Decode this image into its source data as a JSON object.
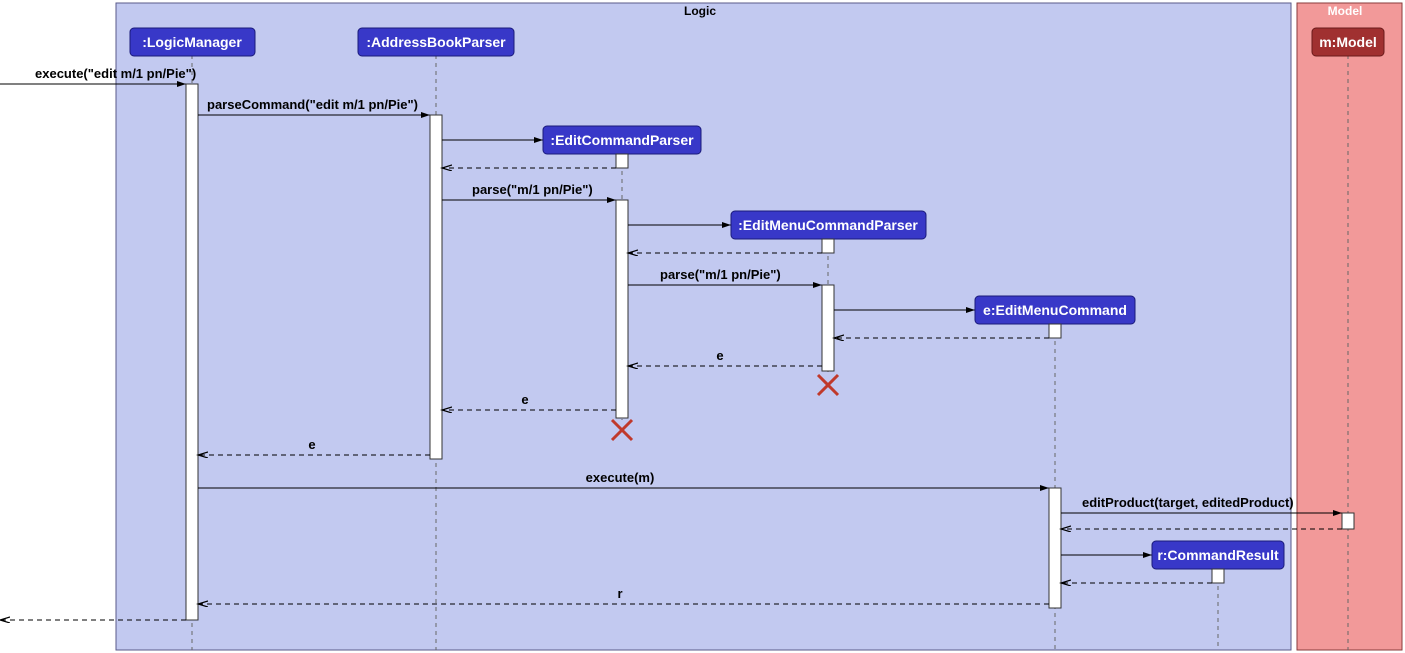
{
  "frames": {
    "logic": {
      "title": "Logic"
    },
    "model": {
      "title": "Model"
    }
  },
  "participants": {
    "logicManager": ":LogicManager",
    "addressBookParser": ":AddressBookParser",
    "editCommandParser": ":EditCommandParser",
    "editMenuCommandParser": ":EditMenuCommandParser",
    "editMenuCommand": "e:EditMenuCommand",
    "commandResult": "r:CommandResult",
    "model": "m:Model"
  },
  "messages": {
    "execute1": "execute(\"edit m/1 pn/Pie\")",
    "parseCommand": "parseCommand(\"edit m/1 pn/Pie\")",
    "parse1": "parse(\"m/1 pn/Pie\")",
    "parse2": "parse(\"m/1 pn/Pie\")",
    "ret_e1": "e",
    "ret_e2": "e",
    "ret_e3": "e",
    "executeM": "execute(m)",
    "editProduct": "editProduct(target, editedProduct)",
    "ret_r": "r"
  },
  "chart_data": {
    "type": "sequence-diagram",
    "frames": [
      {
        "name": "Logic",
        "participants": [
          "LogicManager",
          "AddressBookParser",
          "EditCommandParser",
          "EditMenuCommandParser",
          "EditMenuCommand",
          "CommandResult"
        ]
      },
      {
        "name": "Model",
        "participants": [
          "Model"
        ]
      }
    ],
    "participants": [
      {
        "id": "lm",
        "label": ":LogicManager",
        "created_at_start": true
      },
      {
        "id": "abp",
        "label": ":AddressBookParser",
        "created_at_start": true
      },
      {
        "id": "ecp",
        "label": ":EditCommandParser",
        "created_at_start": false
      },
      {
        "id": "emcp",
        "label": ":EditMenuCommandParser",
        "created_at_start": false
      },
      {
        "id": "emc",
        "label": "e:EditMenuCommand",
        "created_at_start": false
      },
      {
        "id": "cr",
        "label": "r:CommandResult",
        "created_at_start": false
      },
      {
        "id": "m",
        "label": "m:Model",
        "created_at_start": true
      }
    ],
    "messages": [
      {
        "from": "ext",
        "to": "lm",
        "label": "execute(\"edit m/1 pn/Pie\")",
        "type": "sync"
      },
      {
        "from": "lm",
        "to": "abp",
        "label": "parseCommand(\"edit m/1 pn/Pie\")",
        "type": "sync"
      },
      {
        "from": "abp",
        "to": "ecp",
        "label": "",
        "type": "create"
      },
      {
        "from": "ecp",
        "to": "abp",
        "label": "",
        "type": "return"
      },
      {
        "from": "abp",
        "to": "ecp",
        "label": "parse(\"m/1 pn/Pie\")",
        "type": "sync"
      },
      {
        "from": "ecp",
        "to": "emcp",
        "label": "",
        "type": "create"
      },
      {
        "from": "emcp",
        "to": "ecp",
        "label": "",
        "type": "return"
      },
      {
        "from": "ecp",
        "to": "emcp",
        "label": "parse(\"m/1 pn/Pie\")",
        "type": "sync"
      },
      {
        "from": "emcp",
        "to": "emc",
        "label": "",
        "type": "create"
      },
      {
        "from": "emc",
        "to": "emcp",
        "label": "",
        "type": "return"
      },
      {
        "from": "emcp",
        "to": "ecp",
        "label": "e",
        "type": "return"
      },
      {
        "from": "emcp",
        "to": null,
        "label": "",
        "type": "destroy"
      },
      {
        "from": "ecp",
        "to": "abp",
        "label": "e",
        "type": "return"
      },
      {
        "from": "ecp",
        "to": null,
        "label": "",
        "type": "destroy"
      },
      {
        "from": "abp",
        "to": "lm",
        "label": "e",
        "type": "return"
      },
      {
        "from": "lm",
        "to": "emc",
        "label": "execute(m)",
        "type": "sync"
      },
      {
        "from": "emc",
        "to": "m",
        "label": "editProduct(target, editedProduct)",
        "type": "sync"
      },
      {
        "from": "m",
        "to": "emc",
        "label": "",
        "type": "return"
      },
      {
        "from": "emc",
        "to": "cr",
        "label": "",
        "type": "create"
      },
      {
        "from": "cr",
        "to": "emc",
        "label": "",
        "type": "return"
      },
      {
        "from": "emc",
        "to": "lm",
        "label": "r",
        "type": "return"
      },
      {
        "from": "lm",
        "to": "ext",
        "label": "",
        "type": "return"
      }
    ]
  }
}
